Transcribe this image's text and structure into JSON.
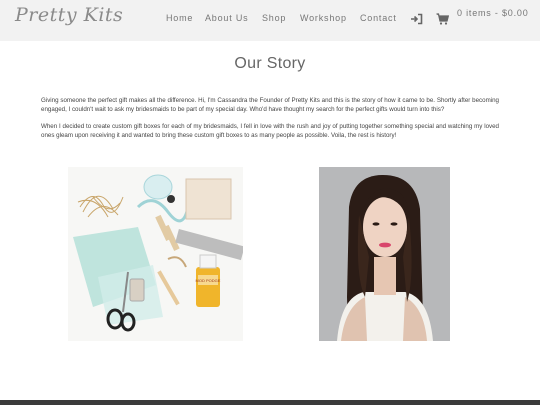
{
  "header": {
    "logo": "Pretty Kits",
    "nav": [
      "Home",
      "About Us",
      "Shop",
      "Workshop",
      "Contact"
    ],
    "login_icon": "login-icon",
    "cart_icon": "cart-icon",
    "cart_text": "0 items - $0.00"
  },
  "main": {
    "title": "Our Story",
    "paragraphs": [
      "Giving someone the perfect gift makes all the difference. Hi, I'm Cassandra the Founder of Pretty Kits and this is the story of how it came to be. Shortly after becoming engaged, I couldn't wait to ask my bridesmaids to be part of my special day. Who'd have thought my search for the perfect gifts would turn into this?",
      "When I decided to create custom gift boxes for each of my bridesmaids, I fell in love with the rush and joy of putting together something special and watching my loved ones gleam upon receiving it and wanted to bring these custom gift boxes to as many people as possible. Voila, the rest is history!"
    ],
    "craft_glue_label": "MOD PODGE"
  },
  "colors": {
    "header_bg": "#f2f2f2",
    "footer_bg": "#3b3b3b",
    "nav_text": "#777777"
  }
}
